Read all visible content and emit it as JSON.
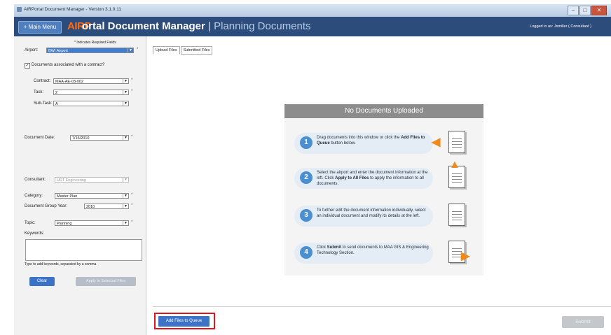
{
  "window": {
    "title": "AIRPortal Document Manager - Version 3.1.0.11"
  },
  "header": {
    "menu_label": "Main Menu",
    "logo_text": "AIRP",
    "app_title": "ortal Document Manager",
    "separator": "|",
    "section": "Planning Documents",
    "logged_in": "Logged in as: Jsmiller ( Consultant )"
  },
  "form": {
    "required_note": "* Indicates Required Fields",
    "airport_label": "Airport:",
    "airport_value": "BWI Airport",
    "contract_checkbox_label": "Documents associated with a contract?",
    "contract_label": "Contract:",
    "contract_value": "MAA-AE-03-002",
    "task_label": "Task:",
    "task_value": "2",
    "subtask_label": "Sub-Task:",
    "subtask_value": "A",
    "docdate_label": "Document Date:",
    "docdate_value": "7/16/2010",
    "consultant_label": "Consultant:",
    "consultant_value": "URT Engineering",
    "category_label": "Category:",
    "category_value": "Master Plan",
    "groupyear_label": "Document Group Year:",
    "groupyear_value": "2010",
    "topic_label": "Topic:",
    "topic_value": "Planning",
    "keywords_label": "Keywords:",
    "keywords_hint": "Type to add keywords, separated by a comma",
    "clear_label": "Clear",
    "apply_label": "Apply to Selected Files",
    "required_mark": "*"
  },
  "tabs": [
    "Upload Files",
    "Submitted Files"
  ],
  "card": {
    "title": "No Documents Uploaded",
    "steps": [
      {
        "num": "1",
        "pre": "Drag documents into this window or click the ",
        "bold": "Add Files to Queue",
        "post": " button below."
      },
      {
        "num": "2",
        "pre": "Select the airport and enter the document information at the left. Click ",
        "bold": "Apply to All Files",
        "post": " to apply the information to all documents."
      },
      {
        "num": "3",
        "pre": "To further edit the document information individually, select an individual document and modify its details at the left.",
        "bold": "",
        "post": ""
      },
      {
        "num": "4",
        "pre": "Click ",
        "bold": "Submit",
        "post": " to send documents to MAA GIS & Engineering Technology Section."
      }
    ]
  },
  "footer": {
    "add_files_label": "Add Files to Queue",
    "submit_label": "Submit"
  },
  "colors": {
    "header": "#2c4d7b",
    "accent": "#3d73c5",
    "logo": "#ff6a10",
    "highlight": "#e0151b"
  }
}
